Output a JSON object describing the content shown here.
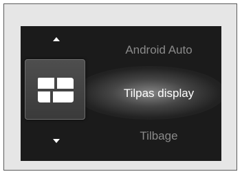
{
  "menu": {
    "items": [
      {
        "label": "Android Auto",
        "state": "unselected"
      },
      {
        "label": "Tilpas display",
        "state": "selected"
      },
      {
        "label": "Tilbage",
        "state": "unselected"
      }
    ],
    "selected_icon": "display-layout-icon"
  },
  "colors": {
    "screen_bg": "#1b1b1b",
    "frame_bg": "#e6e6e6",
    "selected_text": "#ffffff",
    "unselected_text": "#8a8a8a"
  }
}
